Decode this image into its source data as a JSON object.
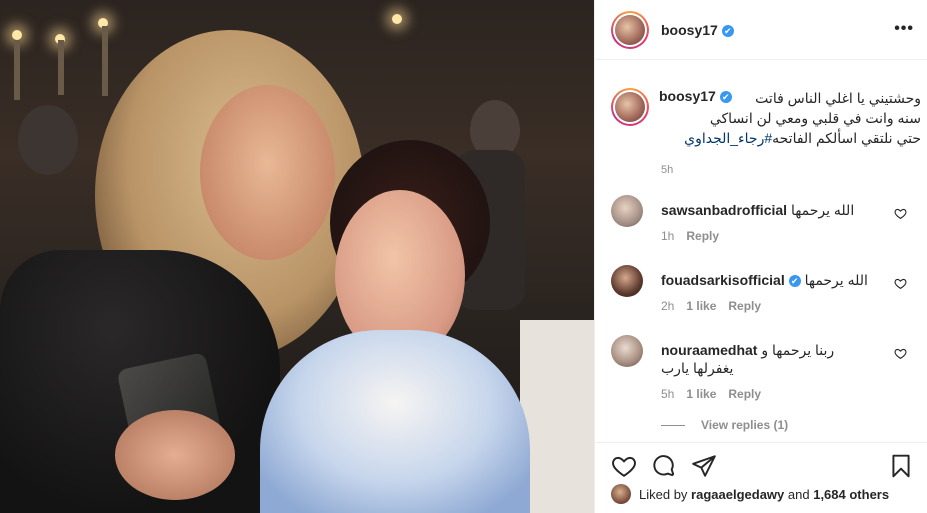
{
  "post": {
    "username": "boosy17",
    "verified_mark": "✔",
    "more_label": "•••",
    "caption": {
      "line1": "وحشتيني يا اغلي الناس فاتت",
      "line2": "سنه وانت في قلبي ومعي لن انساكي",
      "line3_text": "حتي نلتقي اسألكم الفاتحه",
      "hashtag": "#رجاء_الجداوي",
      "time": "5h"
    }
  },
  "comments": [
    {
      "user": "sawsanbadrofficial",
      "verified": false,
      "text": "الله يرحمها",
      "time": "1h",
      "likes": "",
      "reply": "Reply"
    },
    {
      "user": "fouadsarkisofficial",
      "verified": true,
      "text": "الله يرحمها",
      "time": "2h",
      "likes": "1 like",
      "reply": "Reply"
    },
    {
      "user": "nouraamedhat",
      "verified": false,
      "text": "ربنا يرحمها و يغفرلها يارب",
      "time": "5h",
      "likes": "1 like",
      "reply": "Reply"
    }
  ],
  "view_replies": "View replies (1)",
  "likes": {
    "prefix": "Liked by",
    "user": "ragaaelgedawy",
    "and": "and",
    "others": "1,684 others"
  },
  "icons": {
    "like": "heart-icon",
    "comment": "comment-icon",
    "share": "share-icon",
    "save": "bookmark-icon",
    "more": "more-icon"
  },
  "colors": {
    "verified": "#3897f0",
    "hashtag": "#00376b",
    "muted": "#8e8e8e",
    "text": "#262626"
  }
}
